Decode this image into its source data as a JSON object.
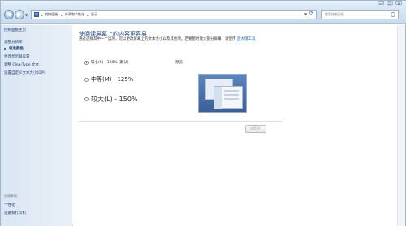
{
  "window": {
    "controls": [
      "—",
      "□",
      "✕"
    ]
  },
  "address_bar": {
    "breadcrumbs": [
      "控制面板",
      "外观和个性化",
      "显示"
    ],
    "search_placeholder": "搜索控制面板"
  },
  "sidebar": {
    "home": "控制面板主页",
    "items": [
      "调整分辨率",
      "校准颜色",
      "更改显示器设置",
      "调整 ClearType 文本",
      "设置自定义文本大小(DPI)"
    ],
    "see_also": "另请参阅",
    "see_also_items": [
      "个性化",
      "设备和打印机"
    ]
  },
  "main": {
    "heading": "使阅读屏幕上的内容更容易",
    "description": "通过选择其中一个选项，可以更改屏幕上的文本大小以及其他项。若要暂时放大部分屏幕，请使用",
    "description_link": "放大镜工具",
    "options": [
      {
        "label": "较小(S) - 100% (默认)",
        "checked": true
      },
      {
        "label": "中等(M) - 125%",
        "checked": false
      },
      {
        "label": "较大(L) - 150%",
        "checked": false
      }
    ],
    "preview_label": "预览",
    "apply_button": "应用(A)"
  }
}
